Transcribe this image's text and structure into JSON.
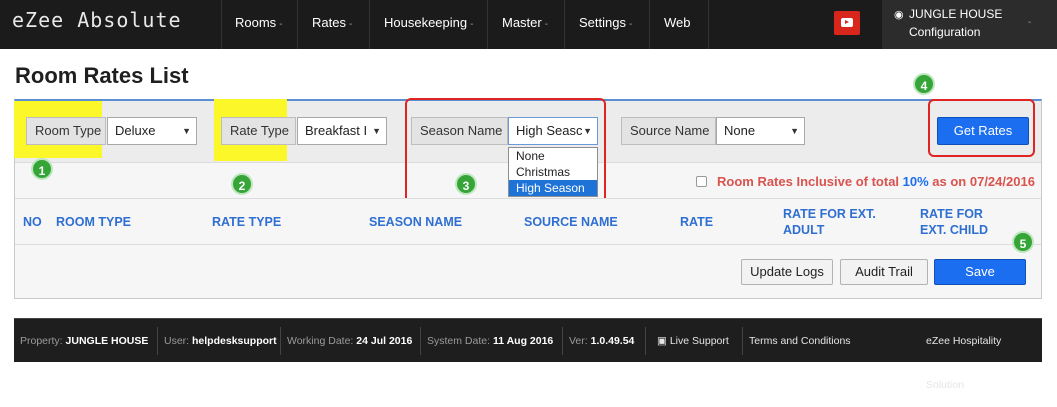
{
  "app": {
    "logo": "eZee Absolute"
  },
  "nav": {
    "items": [
      {
        "label": "Rooms",
        "has_caret": true
      },
      {
        "label": "Rates",
        "has_caret": true
      },
      {
        "label": "Housekeeping",
        "has_caret": true
      },
      {
        "label": "Master",
        "has_caret": true
      },
      {
        "label": "Settings",
        "has_caret": true
      },
      {
        "label": "Web",
        "has_caret": false
      }
    ],
    "caret": "-",
    "youtube_icon": "youtube-icon",
    "user": {
      "icon": "user-icon",
      "name": "JUNGLE HOUSE",
      "subtitle": "Configuration",
      "caret": "-"
    }
  },
  "page": {
    "title": "Room Rates List"
  },
  "filters": {
    "room_type": {
      "label": "Room Type",
      "value": "Deluxe"
    },
    "rate_type": {
      "label": "Rate Type",
      "value": "Breakfast I"
    },
    "season_name": {
      "label": "Season Name",
      "value": "High Seasc",
      "options": [
        "None",
        "Christmas",
        "High Season"
      ],
      "selected_option": "High Season"
    },
    "source_name": {
      "label": "Source Name",
      "value": "None"
    },
    "get_rates_label": "Get Rates"
  },
  "annotations": {
    "badges": [
      "1",
      "2",
      "3",
      "4",
      "5"
    ],
    "highlight_color": "#fbf729",
    "box_color": "#e02424",
    "badge_color": "#35a537"
  },
  "inclusive_note": {
    "text_before": "Room Rates Inclusive of total ",
    "percent": "10%",
    "text_after": " as on 07/24/2016"
  },
  "table": {
    "headers": [
      "NO",
      "ROOM TYPE",
      "RATE TYPE",
      "SEASON NAME",
      "SOURCE NAME",
      "RATE",
      "RATE FOR EXT. ADULT",
      "RATE FOR EXT. CHILD"
    ]
  },
  "actions": {
    "update_logs": "Update Logs",
    "audit_trail": "Audit Trail",
    "save": "Save"
  },
  "footer": {
    "property_label": "Property:",
    "property_value": "JUNGLE HOUSE",
    "user_label": "User:",
    "user_value": "helpdesksupport",
    "working_date_label": "Working Date:",
    "working_date_value": "24 Jul 2016",
    "system_date_label": "System Date:",
    "system_date_value": "11 Aug 2016",
    "version_label": "Ver:",
    "version_value": "1.0.49.54",
    "live_support": "Live Support",
    "terms": "Terms and Conditions",
    "brand": "eZee Hospitality Solution"
  },
  "colors": {
    "accent": "#1c6ef0",
    "header_text": "#2f6fd1",
    "note_red": "#d9534f",
    "topbar": "#1b1b1b"
  }
}
